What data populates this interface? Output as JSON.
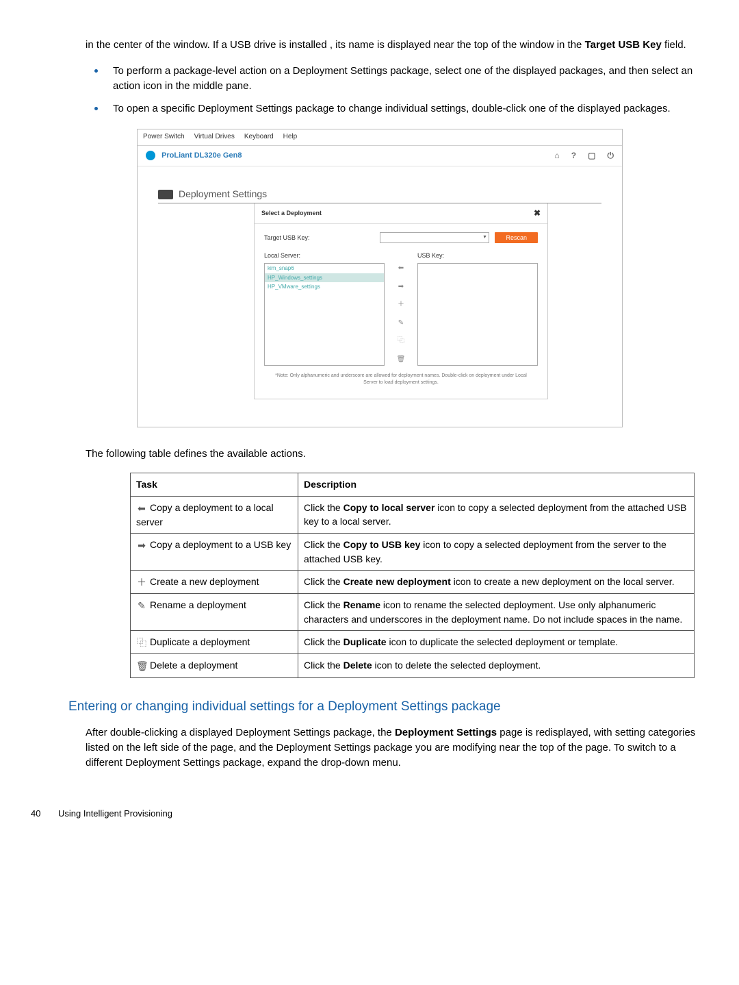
{
  "intro": {
    "text": "in the center of the window. If a USB drive is installed , its name is displayed near the top of the window in the ",
    "bold": "Target USB Key",
    "after": " field."
  },
  "bullets": [
    "To perform a package-level action on a Deployment Settings package, select one of the displayed packages, and then select an action icon in the middle pane.",
    "To open a specific Deployment Settings package to change individual settings, double-click one of the displayed packages."
  ],
  "screenshot": {
    "menubar": [
      "Power Switch",
      "Virtual Drives",
      "Keyboard",
      "Help"
    ],
    "title": "ProLiant DL320e Gen8",
    "title_icons": {
      "home": "⌂",
      "help": "?",
      "maximize": "▢",
      "power": "⏻"
    },
    "section_title": "Deployment Settings",
    "panel_title": "Select a Deployment",
    "close": "✖",
    "target_label": "Target USB Key:",
    "select_caret": "▾",
    "rescan": "Rescan",
    "local_label": "Local Server:",
    "usb_label": "USB Key:",
    "local_items": [
      "kim_snap6",
      "HP_Windows_settings",
      "HP_VMware_settings"
    ],
    "actions": {
      "left": "⬅",
      "right": "➡",
      "add": "＋",
      "rename": "✎",
      "duplicate": "⿻",
      "delete": "🗑"
    },
    "note": "*Note: Only alphanumeric and underscore are allowed for deployment names. Double-click on deployment under Local Server to load deployment settings."
  },
  "after_screenshot": "The following table defines the available actions.",
  "table": {
    "headers": [
      "Task",
      "Description"
    ],
    "rows": [
      {
        "icon": "⬅",
        "task": "Copy a deployment to a local server",
        "desc_pre": "Click the ",
        "desc_bold": "Copy to local server",
        "desc_post": " icon to copy a selected deployment from the attached USB key to a local server."
      },
      {
        "icon": "➡",
        "task": "Copy a deployment to a USB key",
        "desc_pre": "Click the ",
        "desc_bold": "Copy to USB key",
        "desc_post": " icon to copy a selected deployment from the server to the attached USB key."
      },
      {
        "icon": "＋",
        "task": "Create a new deployment",
        "desc_pre": "Click the ",
        "desc_bold": "Create new deployment",
        "desc_post": " icon to create a new deployment on the local server."
      },
      {
        "icon": "✎",
        "task": "Rename a deployment",
        "desc_pre": "Click the ",
        "desc_bold": "Rename",
        "desc_post": " icon to rename the selected deployment. Use only alphanumeric characters and underscores in the deployment name. Do not include spaces in the name."
      },
      {
        "icon": "⿻",
        "task": "Duplicate a deployment",
        "desc_pre": "Click the ",
        "desc_bold": "Duplicate",
        "desc_post": " icon to duplicate the selected deployment or template."
      },
      {
        "icon": "🗑",
        "task": "Delete a deployment",
        "desc_pre": "Click the ",
        "desc_bold": "Delete",
        "desc_post": " icon to delete the selected deployment."
      }
    ]
  },
  "subsection": {
    "heading": "Entering or changing individual settings for a Deployment Settings package",
    "body_pre": "After double-clicking a displayed Deployment Settings package, the ",
    "body_bold": "Deployment Settings",
    "body_post": " page is redisplayed, with setting categories listed on the left side of the page, and the Deployment Settings package you are modifying near the top of the page. To switch to a different Deployment Settings package, expand the drop-down menu."
  },
  "footer": {
    "page": "40",
    "title": "Using Intelligent Provisioning"
  }
}
